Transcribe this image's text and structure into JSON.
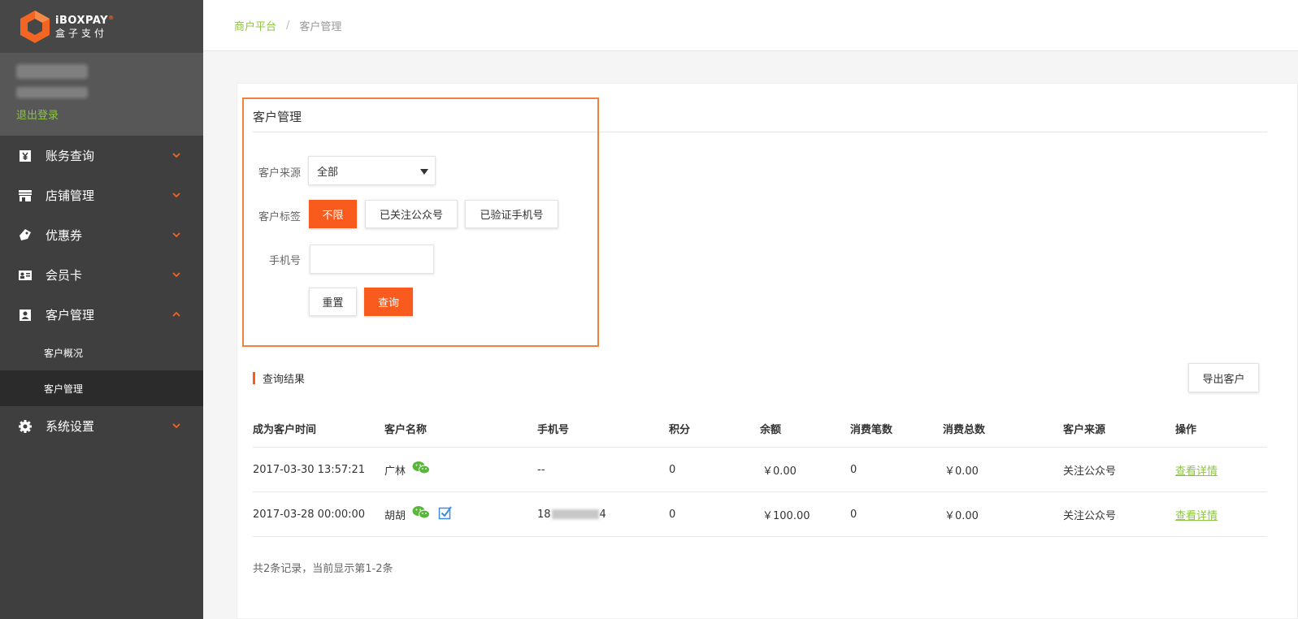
{
  "logo": {
    "en": "iBOX",
    "en_pay": "PAY",
    "cn": "盒子支付",
    "reg": "®"
  },
  "user": {
    "logout_label": "退出登录"
  },
  "sidebar": {
    "items": [
      {
        "label": "账务查询",
        "icon": "yen-icon",
        "expanded": false
      },
      {
        "label": "店铺管理",
        "icon": "store-icon",
        "expanded": false
      },
      {
        "label": "优惠券",
        "icon": "coupon-icon",
        "expanded": false
      },
      {
        "label": "会员卡",
        "icon": "member-card-icon",
        "expanded": false
      },
      {
        "label": "客户管理",
        "icon": "customer-icon",
        "expanded": true
      },
      {
        "label": "系统设置",
        "icon": "gear-icon",
        "expanded": false
      }
    ],
    "subitems": [
      {
        "label": "客户概况",
        "active": false
      },
      {
        "label": "客户管理",
        "active": true
      }
    ]
  },
  "breadcrumb": {
    "root": "商户平台",
    "sep": "/",
    "current": "客户管理"
  },
  "filter": {
    "title": "客户管理",
    "source_label": "客户来源",
    "source_value": "全部",
    "tag_label": "客户标签",
    "tags": [
      "不限",
      "已关注公众号",
      "已验证手机号"
    ],
    "selected_tag": "不限",
    "phone_label": "手机号",
    "phone_value": "",
    "reset_label": "重置",
    "query_label": "查询"
  },
  "results": {
    "title": "查询结果",
    "export_label": "导出客户",
    "columns": [
      "成为客户时间",
      "客户名称",
      "手机号",
      "积分",
      "余额",
      "消费笔数",
      "消费总数",
      "客户来源",
      "操作"
    ],
    "rows": [
      {
        "time": "2017-03-30 13:57:21",
        "name": "广林",
        "wechat": true,
        "verified": false,
        "phone": "--",
        "phone_masked": false,
        "points": "0",
        "balance": "￥0.00",
        "count": "0",
        "total": "￥0.00",
        "source": "关注公众号",
        "action": "查看详情"
      },
      {
        "time": "2017-03-28 00:00:00",
        "name": "胡胡",
        "wechat": true,
        "verified": true,
        "phone_prefix": "18",
        "phone_suffix": "4",
        "phone_masked": true,
        "points": "0",
        "balance": "￥100.00",
        "count": "0",
        "total": "￥0.00",
        "source": "关注公众号",
        "action": "查看详情"
      }
    ],
    "footer": "共2条记录，当前显示第1-2条"
  },
  "colors": {
    "accent_orange": "#f95b1f",
    "highlight_border": "#f0823d",
    "link_green": "#8cc63f",
    "sidebar_bg": "#3f3f3f"
  }
}
